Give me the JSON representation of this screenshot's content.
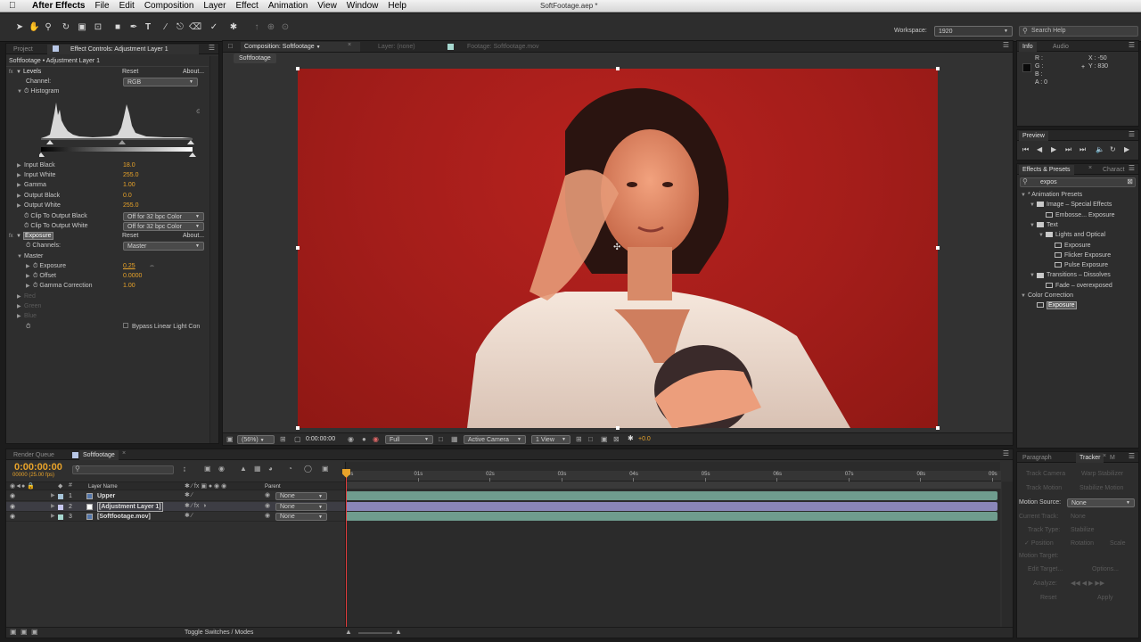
{
  "menubar": {
    "apple": "",
    "app": "After Effects",
    "items": [
      "File",
      "Edit",
      "Composition",
      "Layer",
      "Effect",
      "Animation",
      "View",
      "Window",
      "Help"
    ],
    "document_title": "SoftFootage.aep *"
  },
  "workspace": {
    "label": "Workspace:",
    "value": "1920"
  },
  "search_help": {
    "placeholder": "Search Help"
  },
  "left_panel": {
    "tabs": [
      "Project",
      "Effect Controls: Adjustment Layer 1"
    ],
    "header": "Softfootage • Adjustment Layer 1",
    "levels": {
      "name": "Levels",
      "reset": "Reset",
      "about": "About...",
      "channel_label": "Channel:",
      "channel_value": "RGB",
      "histogram_label": "Histogram",
      "params": [
        {
          "label": "Input Black",
          "value": "18.0"
        },
        {
          "label": "Input White",
          "value": "255.0"
        },
        {
          "label": "Gamma",
          "value": "1.00"
        },
        {
          "label": "Output Black",
          "value": "0.0"
        },
        {
          "label": "Output White",
          "value": "255.0"
        }
      ],
      "clip_black_label": "Clip To Output Black",
      "clip_black_value": "Off for 32 bpc Color",
      "clip_white_label": "Clip To Output White",
      "clip_white_value": "Off for 32 bpc Color"
    },
    "exposure": {
      "name": "Exposure",
      "reset": "Reset",
      "about": "About...",
      "channels_label": "Channels:",
      "channels_value": "Master",
      "master_label": "Master",
      "params": [
        {
          "label": "Exposure",
          "value": "0.25"
        },
        {
          "label": "Offset",
          "value": "0.0000"
        },
        {
          "label": "Gamma Correction",
          "value": "1.00"
        }
      ],
      "disabled": [
        "Red",
        "Green",
        "Blue"
      ],
      "bypass_label": "Bypass Linear Light Con"
    }
  },
  "comp_panel": {
    "tabs": [
      "Composition: Softfootage",
      "Layer: (none)",
      "Footage: Softfootage.mov"
    ],
    "breadcrumb": "Softfootage",
    "footer": {
      "zoom": "(56%)",
      "timecode": "0:00:00:00",
      "resolution": "Full",
      "camera": "Active Camera",
      "views": "1 View",
      "exposure": "+0.0"
    }
  },
  "info_panel": {
    "tabs": [
      "Info",
      "Audio"
    ],
    "channels": [
      "R :",
      "G :",
      "B :",
      "A : 0"
    ],
    "x": "X : -50",
    "y": "Y : 830"
  },
  "preview_panel": {
    "tab": "Preview"
  },
  "effects_panel": {
    "tabs": [
      "Effects & Presets",
      "Charact"
    ],
    "search": "expos",
    "tree": [
      {
        "label": "* Animation Presets",
        "indent": 0,
        "arrow": "▼"
      },
      {
        "label": "Image – Special Effects",
        "indent": 1,
        "arrow": "▼",
        "folder": true
      },
      {
        "label": "Embosse... Exposure",
        "indent": 2,
        "arrow": "",
        "preset": true
      },
      {
        "label": "Text",
        "indent": 1,
        "arrow": "▼",
        "folder": true
      },
      {
        "label": "Lights and Optical",
        "indent": 2,
        "arrow": "▼",
        "folder": true
      },
      {
        "label": "Exposure",
        "indent": 3,
        "arrow": "",
        "preset": true
      },
      {
        "label": "Flicker Exposure",
        "indent": 3,
        "arrow": "",
        "preset": true
      },
      {
        "label": "Pulse Exposure",
        "indent": 3,
        "arrow": "",
        "preset": true
      },
      {
        "label": "Transitions – Dissolves",
        "indent": 1,
        "arrow": "▼",
        "folder": true
      },
      {
        "label": "Fade – overexposed",
        "indent": 2,
        "arrow": "",
        "preset": true
      },
      {
        "label": "Color Correction",
        "indent": 0,
        "arrow": "▼"
      },
      {
        "label": "Exposure",
        "indent": 1,
        "arrow": "",
        "effect": true,
        "selected": true
      }
    ]
  },
  "timeline": {
    "tabs": [
      "Render Queue",
      "Softfootage"
    ],
    "timecode": "0:00:00:00",
    "fps": "00000 (25.00 fps)",
    "columns": {
      "name": "Layer Name",
      "parent": "Parent"
    },
    "ruler": [
      "0s",
      "01s",
      "02s",
      "03s",
      "04s",
      "05s",
      "06s",
      "07s",
      "08s",
      "09s"
    ],
    "layers": [
      {
        "num": "1",
        "name": "Upper",
        "parent": "None",
        "color": "#a6c4d8",
        "bar": "#6f9c8e"
      },
      {
        "num": "2",
        "name": "[Adjustment Layer 1]",
        "parent": "None",
        "color": "#c7c7f0",
        "bar": "#8a86b8"
      },
      {
        "num": "3",
        "name": "[Softfootage.mov]",
        "parent": "None",
        "color": "#a6d8cf",
        "bar": "#6f9c8e"
      }
    ],
    "toggle_label": "Toggle Switches / Modes"
  },
  "tracker": {
    "tabs": [
      "Paragraph",
      "Tracker",
      "M"
    ],
    "track_camera": "Track Camera",
    "warp_stabilizer": "Warp Stabilizer",
    "track_motion": "Track Motion",
    "stabilize_motion": "Stabilize Motion",
    "motion_source_label": "Motion Source:",
    "motion_source_value": "None",
    "current_track_label": "Current Track:",
    "current_track_value": "None",
    "track_type_label": "Track Type:",
    "track_type_value": "Stabilize",
    "checks": [
      "Position",
      "Rotation",
      "Scale"
    ],
    "motion_target": "Motion Target:",
    "edit_target": "Edit Target...",
    "options": "Options...",
    "analyze": "Analyze:",
    "reset": "Reset",
    "apply": "Apply"
  }
}
